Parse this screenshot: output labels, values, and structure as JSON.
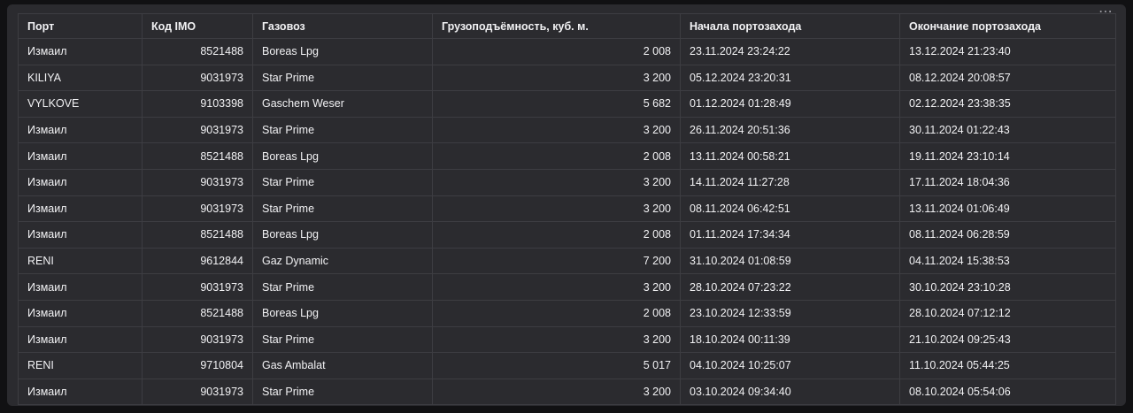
{
  "menu_icon": "more-horizontal-icon",
  "table": {
    "headers": {
      "port": "Порт",
      "imo": "Код IMO",
      "ship": "Газовоз",
      "capacity": "Грузоподъёмность, куб. м.",
      "start": "Начала портозахода",
      "end": "Окончание портозахода"
    },
    "rows": [
      {
        "port": "Измаил",
        "imo": "8521488",
        "ship": "Boreas Lpg",
        "capacity": "2 008",
        "start": "23.11.2024 23:24:22",
        "end": "13.12.2024 21:23:40"
      },
      {
        "port": "KILIYA",
        "imo": "9031973",
        "ship": "Star Prime",
        "capacity": "3 200",
        "start": "05.12.2024 23:20:31",
        "end": "08.12.2024 20:08:57"
      },
      {
        "port": "VYLKOVE",
        "imo": "9103398",
        "ship": "Gaschem Weser",
        "capacity": "5 682",
        "start": "01.12.2024 01:28:49",
        "end": "02.12.2024 23:38:35"
      },
      {
        "port": "Измаил",
        "imo": "9031973",
        "ship": "Star Prime",
        "capacity": "3 200",
        "start": "26.11.2024 20:51:36",
        "end": "30.11.2024 01:22:43"
      },
      {
        "port": "Измаил",
        "imo": "8521488",
        "ship": "Boreas Lpg",
        "capacity": "2 008",
        "start": "13.11.2024 00:58:21",
        "end": "19.11.2024 23:10:14"
      },
      {
        "port": "Измаил",
        "imo": "9031973",
        "ship": "Star Prime",
        "capacity": "3 200",
        "start": "14.11.2024 11:27:28",
        "end": "17.11.2024 18:04:36"
      },
      {
        "port": "Измаил",
        "imo": "9031973",
        "ship": "Star Prime",
        "capacity": "3 200",
        "start": "08.11.2024 06:42:51",
        "end": "13.11.2024 01:06:49"
      },
      {
        "port": "Измаил",
        "imo": "8521488",
        "ship": "Boreas Lpg",
        "capacity": "2 008",
        "start": "01.11.2024 17:34:34",
        "end": "08.11.2024 06:28:59"
      },
      {
        "port": "RENI",
        "imo": "9612844",
        "ship": "Gaz Dynamic",
        "capacity": "7 200",
        "start": "31.10.2024 01:08:59",
        "end": "04.11.2024 15:38:53"
      },
      {
        "port": "Измаил",
        "imo": "9031973",
        "ship": "Star Prime",
        "capacity": "3 200",
        "start": "28.10.2024 07:23:22",
        "end": "30.10.2024 23:10:28"
      },
      {
        "port": "Измаил",
        "imo": "8521488",
        "ship": "Boreas Lpg",
        "capacity": "2 008",
        "start": "23.10.2024 12:33:59",
        "end": "28.10.2024 07:12:12"
      },
      {
        "port": "Измаил",
        "imo": "9031973",
        "ship": "Star Prime",
        "capacity": "3 200",
        "start": "18.10.2024 00:11:39",
        "end": "21.10.2024 09:25:43"
      },
      {
        "port": "RENI",
        "imo": "9710804",
        "ship": "Gas Ambalat",
        "capacity": "5 017",
        "start": "04.10.2024 10:25:07",
        "end": "11.10.2024 05:44:25"
      },
      {
        "port": "Измаил",
        "imo": "9031973",
        "ship": "Star Prime",
        "capacity": "3 200",
        "start": "03.10.2024 09:34:40",
        "end": "08.10.2024 05:54:06"
      }
    ]
  }
}
